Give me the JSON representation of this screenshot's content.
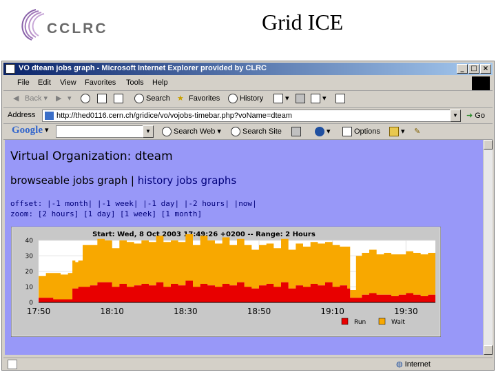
{
  "slide": {
    "logo_text": "CCLRC",
    "title": "Grid ICE"
  },
  "window": {
    "title": "VO dteam jobs graph - Microsoft Internet Explorer provided by CLRC"
  },
  "menu": [
    "File",
    "Edit",
    "View",
    "Favorites",
    "Tools",
    "Help"
  ],
  "toolbar": {
    "back": "Back",
    "search": "Search",
    "favorites": "Favorites",
    "history": "History"
  },
  "address": {
    "label": "Address",
    "url": "http://thed0116.cern.ch/gridice/vo/vojobs-timebar.php?voName=dteam",
    "go": "Go"
  },
  "google": {
    "logo": "Google",
    "search_web": "Search Web",
    "search_site": "Search Site",
    "options": "Options"
  },
  "page": {
    "heading": "Virtual Organization: dteam",
    "links": {
      "browseable": "browseable jobs graph",
      "separator": "|",
      "history": "history jobs graphs"
    },
    "offset": {
      "label": "offset:",
      "items": [
        "-1 month",
        "-1 week",
        "-1 day",
        "-2 hours",
        "now"
      ]
    },
    "zoom": {
      "label": "zoom:",
      "items": [
        "[2 hours]",
        "[1 day]",
        "[1 week]",
        "[1 month]"
      ]
    }
  },
  "chart_data": {
    "type": "area",
    "title": "Start: Wed, 8 Oct 2003 17:49:26 +0200 -- Range: 2 Hours",
    "xlabel": "",
    "ylabel": "",
    "ylim": [
      0,
      40
    ],
    "yticks": [
      0,
      10,
      20,
      30,
      40
    ],
    "xticks": [
      "17:50",
      "18:10",
      "18:30",
      "18:50",
      "19:10",
      "19:30"
    ],
    "colors": {
      "Run": "#e80000",
      "Wait": "#f8a800"
    },
    "legend": [
      "Run",
      "Wait"
    ],
    "legend_placement": "bottom-right",
    "x_minutes": [
      0,
      10,
      20,
      30,
      40,
      46,
      50,
      54,
      60,
      70,
      80,
      90,
      100,
      110,
      120,
      130,
      140,
      150,
      160,
      170,
      180,
      190,
      200,
      210,
      220,
      230,
      240,
      250,
      260,
      270,
      280,
      290,
      300,
      310,
      320,
      330,
      340,
      350,
      360,
      370,
      380,
      390,
      400,
      410,
      420,
      424,
      428,
      432,
      440,
      450,
      460,
      470,
      480,
      490,
      500,
      510,
      520,
      530,
      540
    ],
    "series": [
      {
        "name": "Run",
        "values": [
          3,
          3,
          2,
          2,
          2,
          9,
          9,
          10,
          10,
          11,
          13,
          13,
          10,
          12,
          10,
          11,
          12,
          11,
          13,
          10,
          12,
          11,
          14,
          10,
          12,
          11,
          10,
          12,
          11,
          13,
          10,
          9,
          11,
          12,
          10,
          13,
          9,
          11,
          10,
          12,
          11,
          13,
          10,
          11,
          9,
          3,
          3,
          3,
          5,
          6,
          5,
          5,
          4,
          5,
          6,
          5,
          4,
          5,
          5
        ]
      },
      {
        "name": "Wait",
        "values": [
          14,
          16,
          17,
          16,
          17,
          18,
          17,
          17,
          27,
          26,
          28,
          27,
          25,
          28,
          29,
          27,
          28,
          28,
          30,
          29,
          28,
          28,
          30,
          27,
          31,
          29,
          28,
          30,
          26,
          28,
          27,
          25,
          26,
          26,
          25,
          28,
          25,
          27,
          26,
          27,
          27,
          26,
          27,
          25,
          27,
          5,
          5,
          27,
          27,
          28,
          26,
          27,
          27,
          26,
          27,
          27,
          27,
          27,
          27
        ]
      }
    ]
  }
}
